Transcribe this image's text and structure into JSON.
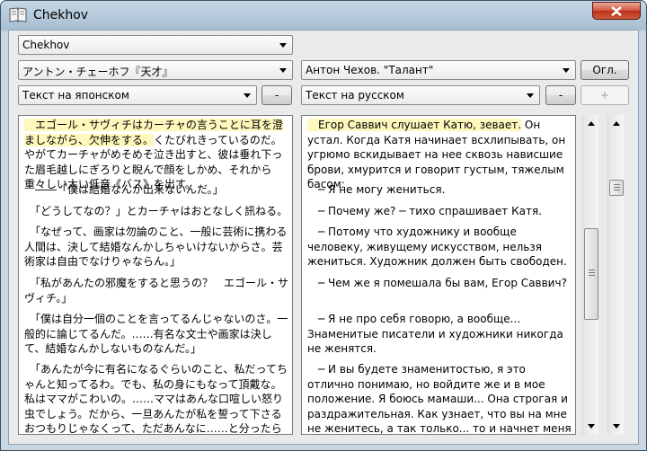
{
  "window": {
    "title": "Chekhov"
  },
  "selectors": {
    "author": "Chekhov",
    "source_title": "アントン・チェーホフ『天才』",
    "target_title": "Антон Чехов. \"Талант\"",
    "source_lang": "Текст на японском",
    "target_lang": "Текст на русском"
  },
  "buttons": {
    "contents": "Огл.",
    "remove_left": "-",
    "remove_right": "-",
    "add": "+"
  },
  "japanese_text": [
    {
      "text": "　エゴール・サヴィチはカーチャの言うことに耳を澄ましながら、欠伸をする。",
      "highlight": true
    },
    {
      "text": "くたびれきっているのだ。やがてカーチャがめそめそ泣き出すと、彼は垂れ下った眉毛越しにぎろりと睨んで顔をしかめ、それから重々しい太い低音《バス》を出す。",
      "highlight": false
    },
    {
      "text": "　――「僕は結婚なんか出来ないんだ。」",
      "highlight": false
    },
    {
      "text": "　「どうしてなの？」とカーチャはおとなしく訊ねる。",
      "highlight": false
    },
    {
      "text": "　「なぜって、画家は勿論のこと、一般に芸術に携わる人間は、決して結婚なんかしちゃいけないからさ。芸術家は自由でなけりゃならん。」",
      "highlight": false
    },
    {
      "text": "　「私があんたの邪魔をすると思うの？　エゴール・サヴィチ。」",
      "highlight": false
    },
    {
      "text": "　「僕は自分一個のことを言ってるんじゃないのさ。一般的に論じてるんだ。……有名な文士や画家は決して、結婚なんかしないものなんだ。」",
      "highlight": false
    },
    {
      "text": "　「あんたが今に有名になるぐらいのこと、私だってちゃんと知ってるわ。でも、私の身にもなって頂戴な。私はママがこわいの。……ママはあんな口喧しい怒り虫でしょう。だから、一旦あんたが私を誓って下さるおつもりじゃなくって、ただあんなに……と分ったら最後、私をひどい目にあわせるにきまってるわ。",
      "highlight": false
    }
  ],
  "russian_text": [
    {
      "text": "　Егор Саввич слушает Катю, зевает.",
      "highlight": true,
      "tail": " Он устал. Когда Катя начинает всхлипывать, он угрюмо вскидывает на нее сквозь нависшие брови, хмурится и говорит густым, тяжелым басом:"
    },
    {
      "text": "　─ Я не могу жениться."
    },
    {
      "text": "　─ Почему же? ─ тихо спрашивает Катя."
    },
    {
      "text": "　─ Потому что художнику и вообще человеку, живущему искусством, нельзя жениться. Художник должен быть свободен."
    },
    {
      "text": "　─ Чем же я помешала бы вам, Егор Саввич?"
    },
    {
      "text": "　─ Я не про себя говорю, а вообще... Знаменитые писатели и художники никогда не женятся."
    },
    {
      "text": "　─ И вы будете знаменитостью, я это отлично понимаю, но войдите же и в мое положение. Я боюсь мамаши... Она строгая и раздражительная. Как узнает, что вы на мне не женитесь, а так только... то и начнет меня изводить. О, горе мое! А тут вы еще"
    }
  ]
}
